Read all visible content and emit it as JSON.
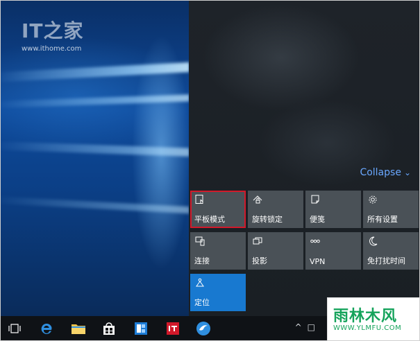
{
  "watermark_site": {
    "brand": "IT之家",
    "url": "www.ithome.com"
  },
  "action_center": {
    "collapse_label": "Collapse",
    "tiles": [
      {
        "label": "平板模式",
        "icon": "tablet-mode-icon",
        "state": "selected"
      },
      {
        "label": "旋转锁定",
        "icon": "rotation-lock-icon",
        "state": "off"
      },
      {
        "label": "便笺",
        "icon": "note-icon",
        "state": "off"
      },
      {
        "label": "所有设置",
        "icon": "gear-icon",
        "state": "off"
      },
      {
        "label": "连接",
        "icon": "connect-icon",
        "state": "off"
      },
      {
        "label": "投影",
        "icon": "project-icon",
        "state": "off"
      },
      {
        "label": "VPN",
        "icon": "vpn-icon",
        "state": "off"
      },
      {
        "label": "免打扰时间",
        "icon": "quiet-hours-icon",
        "state": "off"
      },
      {
        "label": "定位",
        "icon": "location-icon",
        "state": "on"
      }
    ]
  },
  "taskbar": {
    "items": [
      {
        "name": "task-view-icon"
      },
      {
        "name": "edge-browser-icon"
      },
      {
        "name": "file-explorer-icon"
      },
      {
        "name": "store-icon"
      },
      {
        "name": "outlook-icon"
      },
      {
        "name": "ithome-app-icon"
      },
      {
        "name": "bird-app-icon"
      }
    ],
    "tray": [
      "^",
      "□"
    ]
  },
  "watermark_corner": {
    "title": "雨林木风",
    "url": "WWW.YLMFU.COM"
  },
  "colors": {
    "accent": "#1879d0",
    "highlight_border": "#d2192a",
    "tile_bg": "#4a5157",
    "link": "#6aa8ff"
  }
}
